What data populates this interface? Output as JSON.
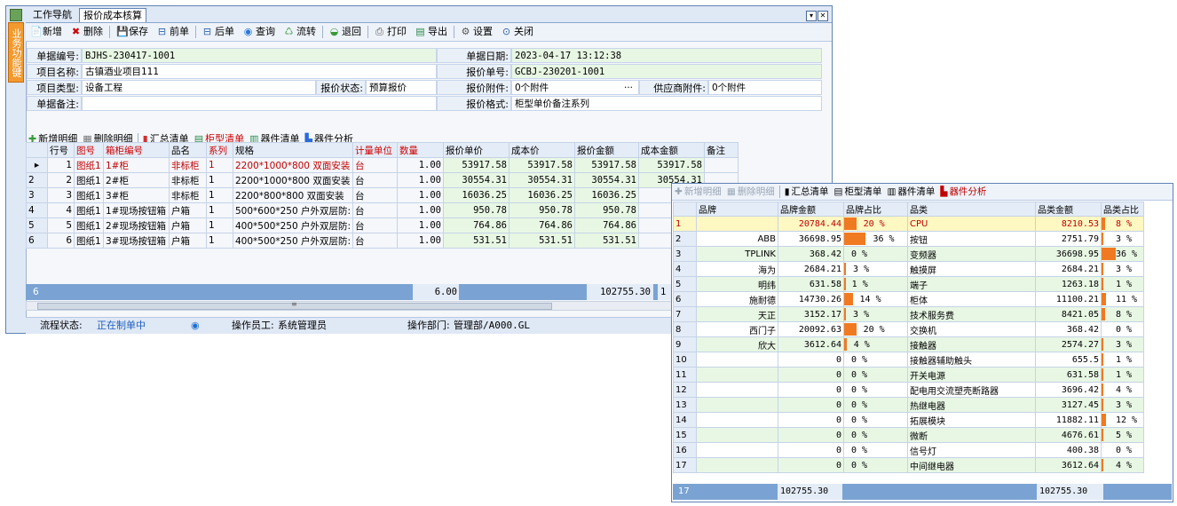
{
  "tabs": {
    "nav": "工作导航",
    "active": "报价成本核算"
  },
  "side_tab": "业务功能键",
  "toolbar": [
    {
      "icon": "📄",
      "label": "新增",
      "name": "new-button",
      "color": "#000"
    },
    {
      "icon": "✖",
      "label": "删除",
      "name": "delete-button",
      "color": "#d00000"
    },
    {
      "icon": "💾",
      "label": "保存",
      "name": "save-button",
      "color": "#2a5fa8"
    },
    {
      "icon": "⊟",
      "label": "前单",
      "name": "prev-button",
      "color": "#2a5fa8"
    },
    {
      "icon": "⊟",
      "label": "后单",
      "name": "next-button",
      "color": "#2a5fa8"
    },
    {
      "icon": "◉",
      "label": "查询",
      "name": "query-button",
      "color": "#2a7ad8"
    },
    {
      "icon": "♺",
      "label": "流转",
      "name": "flow-button",
      "color": "#3a9a3a"
    },
    {
      "icon": "◒",
      "label": "退回",
      "name": "return-button",
      "color": "#3a9a3a"
    },
    {
      "icon": "⎙",
      "label": "打印",
      "name": "print-button",
      "color": "#555"
    },
    {
      "icon": "▤",
      "label": "导出",
      "name": "export-button",
      "color": "#2a8a4a"
    },
    {
      "icon": "⚙",
      "label": "设置",
      "name": "settings-button",
      "color": "#555"
    },
    {
      "icon": "⊙",
      "label": "关闭",
      "name": "close-button",
      "color": "#2a5fa8"
    }
  ],
  "form": {
    "doc_no_label": "单据编号:",
    "doc_no": "BJHS-230417-1001",
    "doc_date_label": "单据日期:",
    "doc_date": "2023-04-17 13:12:38",
    "project_name_label": "项目名称:",
    "project_name": "古镇酒业项目111",
    "quote_no_label": "报价单号:",
    "quote_no": "GCBJ-230201-1001",
    "project_type_label": "项目类型:",
    "project_type": "设备工程",
    "quote_status_label": "报价状态:",
    "quote_status": "预算报价",
    "quote_attach_label": "报价附件:",
    "quote_attach": "0个附件",
    "quote_attach_more": "···",
    "supplier_attach_label": "供应商附件:",
    "supplier_attach": "0个附件",
    "remark_label": "单据备注:",
    "remark": "",
    "quote_format_label": "报价格式:",
    "quote_format": "柜型单价备注系列"
  },
  "detail_toolbar": [
    {
      "icon": "✚",
      "label": "新增明细",
      "name": "add-detail-button",
      "color": "#3a9a3a"
    },
    {
      "icon": "▦",
      "label": "删除明细",
      "name": "delete-detail-button",
      "color": "#777"
    },
    {
      "icon": "▮",
      "label": "汇总清单",
      "name": "summary-list-button",
      "color": "#d03030"
    },
    {
      "icon": "▤",
      "label": "柜型清单",
      "name": "cabinet-list-button",
      "color": "#2a8a4a"
    },
    {
      "icon": "▥",
      "label": "器件清单",
      "name": "component-list-button",
      "color": "#2a8a4a"
    },
    {
      "icon": "▙",
      "label": "器件分析",
      "name": "component-analysis-button",
      "color": "#2a6ad8"
    }
  ],
  "main_grid": {
    "headers": [
      "行号",
      "图号",
      "箱柜编号",
      "品名",
      "系列",
      "规格",
      "计量单位",
      "数量",
      "报价单价",
      "成本价",
      "报价金额",
      "成本金额",
      "备注"
    ],
    "rows": [
      [
        "1",
        "图纸1",
        "1#柜",
        "非标柜",
        "1",
        "2200*1000*800 双面安装",
        "台",
        "1.00",
        "53917.58",
        "53917.58",
        "53917.58",
        "53917.58",
        ""
      ],
      [
        "2",
        "图纸1",
        "2#柜",
        "非标柜",
        "1",
        "2200*1000*800 双面安装",
        "台",
        "1.00",
        "30554.31",
        "30554.31",
        "30554.31",
        "30554.31",
        ""
      ],
      [
        "3",
        "图纸1",
        "3#柜",
        "非标柜",
        "1",
        "2200*800*800 双面安装",
        "台",
        "1.00",
        "16036.25",
        "16036.25",
        "16036.25",
        "",
        ""
      ],
      [
        "4",
        "图纸1",
        "1#现场按钮箱",
        "户箱",
        "1",
        "500*600*250 户外双层防:",
        "台",
        "1.00",
        "950.78",
        "950.78",
        "950.78",
        "",
        ""
      ],
      [
        "5",
        "图纸1",
        "2#现场按钮箱",
        "户箱",
        "1",
        "400*500*250 户外双层防:",
        "台",
        "1.00",
        "764.86",
        "764.86",
        "764.86",
        "",
        ""
      ],
      [
        "6",
        "图纸1",
        "3#现场按钮箱",
        "户箱",
        "1",
        "400*500*250 户外双层防:",
        "台",
        "1.00",
        "531.51",
        "531.51",
        "531.51",
        "",
        ""
      ]
    ],
    "row_marker": "▸",
    "side_numbers": [
      "1",
      "2",
      "3",
      "4",
      "5",
      "6"
    ],
    "footer_count": "6",
    "footer_qty": "6.00",
    "footer_amount": "102755.30",
    "footer_amount2": "1",
    "scroll_mark": "≡"
  },
  "status": {
    "flow_label": "流程状态:",
    "flow_value": "正在制单中",
    "operator_label": "操作员工:",
    "operator_value": "系统管理员",
    "dept_label": "操作部门:",
    "dept_value": "管理部/A000.GL"
  },
  "analysis": {
    "toolbar": [
      {
        "icon": "✚",
        "label": "新增明细",
        "name": "an-add-detail-button",
        "state": "dis"
      },
      {
        "icon": "▦",
        "label": "删除明细",
        "name": "an-delete-detail-button",
        "state": "dis"
      },
      {
        "icon": "▮",
        "label": "汇总清单",
        "name": "an-summary-list-button",
        "state": ""
      },
      {
        "icon": "▤",
        "label": "柜型清单",
        "name": "an-cabinet-list-button",
        "state": ""
      },
      {
        "icon": "▥",
        "label": "器件清单",
        "name": "an-component-list-button",
        "state": ""
      },
      {
        "icon": "▙",
        "label": "器件分析",
        "name": "an-component-analysis-button",
        "state": "act"
      }
    ],
    "headers": [
      "",
      "品牌",
      "品牌金额",
      "品牌占比",
      "品类",
      "品类金额",
      "品类占比"
    ],
    "rows": [
      {
        "n": "1",
        "brand": "",
        "brand_amt": "20784.44",
        "brand_pct": "20 %",
        "brand_ratio": 0.2,
        "cat": "CPU",
        "cat_amt": "8210.53",
        "cat_pct": "8 %",
        "cat_ratio": 0.08
      },
      {
        "n": "2",
        "brand": "ABB",
        "brand_amt": "36698.95",
        "brand_pct": "36 %",
        "brand_ratio": 0.36,
        "cat": "按钮",
        "cat_amt": "2751.79",
        "cat_pct": "3 %",
        "cat_ratio": 0.03
      },
      {
        "n": "3",
        "brand": "TPLINK",
        "brand_amt": "368.42",
        "brand_pct": "0 %",
        "brand_ratio": 0.0,
        "cat": "变频器",
        "cat_amt": "36698.95",
        "cat_pct": "36 %",
        "cat_ratio": 0.36
      },
      {
        "n": "4",
        "brand": "海为",
        "brand_amt": "2684.21",
        "brand_pct": "3 %",
        "brand_ratio": 0.03,
        "cat": "触摸屏",
        "cat_amt": "2684.21",
        "cat_pct": "3 %",
        "cat_ratio": 0.03
      },
      {
        "n": "5",
        "brand": "明纬",
        "brand_amt": "631.58",
        "brand_pct": "1 %",
        "brand_ratio": 0.01,
        "cat": "端子",
        "cat_amt": "1263.18",
        "cat_pct": "1 %",
        "cat_ratio": 0.01
      },
      {
        "n": "6",
        "brand": "施耐德",
        "brand_amt": "14730.26",
        "brand_pct": "14 %",
        "brand_ratio": 0.14,
        "cat": "柜体",
        "cat_amt": "11100.21",
        "cat_pct": "11 %",
        "cat_ratio": 0.11
      },
      {
        "n": "7",
        "brand": "天正",
        "brand_amt": "3152.17",
        "brand_pct": "3 %",
        "brand_ratio": 0.03,
        "cat": "技术服务费",
        "cat_amt": "8421.05",
        "cat_pct": "8 %",
        "cat_ratio": 0.08
      },
      {
        "n": "8",
        "brand": "西门子",
        "brand_amt": "20092.63",
        "brand_pct": "20 %",
        "brand_ratio": 0.2,
        "cat": "交换机",
        "cat_amt": "368.42",
        "cat_pct": "0 %",
        "cat_ratio": 0.0
      },
      {
        "n": "9",
        "brand": "欣大",
        "brand_amt": "3612.64",
        "brand_pct": "4 %",
        "brand_ratio": 0.04,
        "cat": "接触器",
        "cat_amt": "2574.27",
        "cat_pct": "3 %",
        "cat_ratio": 0.03
      },
      {
        "n": "10",
        "brand": "",
        "brand_amt": "0",
        "brand_pct": "0 %",
        "brand_ratio": 0.0,
        "cat": "接触器辅助触头",
        "cat_amt": "655.5",
        "cat_pct": "1 %",
        "cat_ratio": 0.01
      },
      {
        "n": "11",
        "brand": "",
        "brand_amt": "0",
        "brand_pct": "0 %",
        "brand_ratio": 0.0,
        "cat": "开关电源",
        "cat_amt": "631.58",
        "cat_pct": "1 %",
        "cat_ratio": 0.01
      },
      {
        "n": "12",
        "brand": "",
        "brand_amt": "0",
        "brand_pct": "0 %",
        "brand_ratio": 0.0,
        "cat": "配电用交流塑壳断路器",
        "cat_amt": "3696.42",
        "cat_pct": "4 %",
        "cat_ratio": 0.04
      },
      {
        "n": "13",
        "brand": "",
        "brand_amt": "0",
        "brand_pct": "0 %",
        "brand_ratio": 0.0,
        "cat": "热继电器",
        "cat_amt": "3127.45",
        "cat_pct": "3 %",
        "cat_ratio": 0.03
      },
      {
        "n": "14",
        "brand": "",
        "brand_amt": "0",
        "brand_pct": "0 %",
        "brand_ratio": 0.0,
        "cat": "拓展模块",
        "cat_amt": "11882.11",
        "cat_pct": "12 %",
        "cat_ratio": 0.12
      },
      {
        "n": "15",
        "brand": "",
        "brand_amt": "0",
        "brand_pct": "0 %",
        "brand_ratio": 0.0,
        "cat": "微断",
        "cat_amt": "4676.61",
        "cat_pct": "5 %",
        "cat_ratio": 0.05
      },
      {
        "n": "16",
        "brand": "",
        "brand_amt": "0",
        "brand_pct": "0 %",
        "brand_ratio": 0.0,
        "cat": "信号灯",
        "cat_amt": "400.38",
        "cat_pct": "0 %",
        "cat_ratio": 0.0
      },
      {
        "n": "17",
        "brand": "",
        "brand_amt": "0",
        "brand_pct": "0 %",
        "brand_ratio": 0.0,
        "cat": "中间继电器",
        "cat_amt": "3612.64",
        "cat_pct": "4 %",
        "cat_ratio": 0.04
      }
    ],
    "footer_count": "17",
    "footer_brand_total": "102755.30",
    "footer_cat_total": "102755.30"
  },
  "colors": {
    "bar": "#f07a22",
    "accent": "#5f83b5",
    "green_cell": "#e8f7e4",
    "red": "#d00000"
  }
}
